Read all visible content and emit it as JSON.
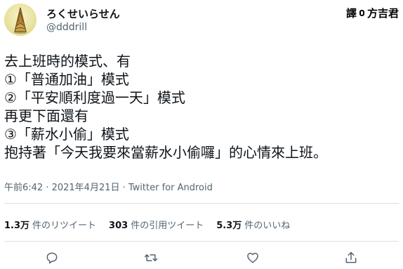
{
  "author": {
    "display_name": "ろくせいらせん",
    "handle": "@dddrill"
  },
  "watermark": {
    "left": "譯",
    "right": "方吉君"
  },
  "tweet": {
    "lines": [
      "去上班時的模式、有",
      "①「普通加油」模式",
      "②「平安順利度過一天」模式",
      "再更下面還有",
      "③「薪水小偷」模式",
      "抱持著「今天我要來當薪水小偷囉」的心情來上班。"
    ]
  },
  "meta": {
    "timestamp": "午前6:42 · 2021年4月21日 · Twitter for Android"
  },
  "stats": {
    "retweets": {
      "count": "1.3万",
      "label": "件のリツイート"
    },
    "quotes": {
      "count": "303",
      "label": "件の引用ツイート"
    },
    "likes": {
      "count": "5.3万",
      "label": "件のいいね"
    }
  },
  "actions": {
    "icons": [
      "reply-icon",
      "retweet-icon",
      "like-icon",
      "share-icon"
    ]
  },
  "colors": {
    "text": "#0f1419",
    "secondary": "#536471",
    "divider": "#dcdfe2"
  }
}
